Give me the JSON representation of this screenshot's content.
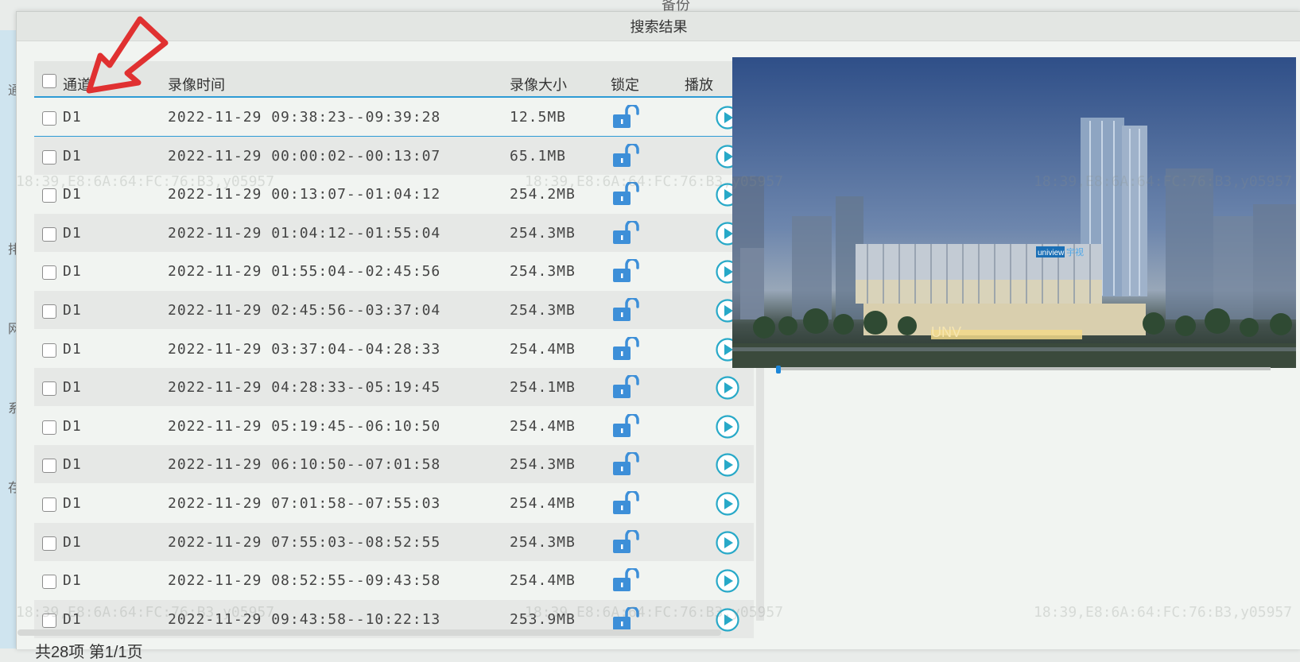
{
  "dialog": {
    "title": "搜索结果"
  },
  "background": {
    "top_text": "备份",
    "left_chars": [
      "通",
      "排",
      "网",
      "系",
      "存"
    ]
  },
  "table": {
    "headers": {
      "channel": "通道",
      "time": "录像时间",
      "size": "录像大小",
      "lock": "锁定",
      "play": "播放"
    },
    "rows": [
      {
        "channel": "D1",
        "time": "2022-11-29 09:38:23--09:39:28",
        "size": "12.5MB"
      },
      {
        "channel": "D1",
        "time": "2022-11-29 00:00:02--00:13:07",
        "size": "65.1MB"
      },
      {
        "channel": "D1",
        "time": "2022-11-29 00:13:07--01:04:12",
        "size": "254.2MB"
      },
      {
        "channel": "D1",
        "time": "2022-11-29 01:04:12--01:55:04",
        "size": "254.3MB"
      },
      {
        "channel": "D1",
        "time": "2022-11-29 01:55:04--02:45:56",
        "size": "254.3MB"
      },
      {
        "channel": "D1",
        "time": "2022-11-29 02:45:56--03:37:04",
        "size": "254.3MB"
      },
      {
        "channel": "D1",
        "time": "2022-11-29 03:37:04--04:28:33",
        "size": "254.4MB"
      },
      {
        "channel": "D1",
        "time": "2022-11-29 04:28:33--05:19:45",
        "size": "254.1MB"
      },
      {
        "channel": "D1",
        "time": "2022-11-29 05:19:45--06:10:50",
        "size": "254.4MB"
      },
      {
        "channel": "D1",
        "time": "2022-11-29 06:10:50--07:01:58",
        "size": "254.3MB"
      },
      {
        "channel": "D1",
        "time": "2022-11-29 07:01:58--07:55:03",
        "size": "254.4MB"
      },
      {
        "channel": "D1",
        "time": "2022-11-29 07:55:03--08:52:55",
        "size": "254.3MB"
      },
      {
        "channel": "D1",
        "time": "2022-11-29 08:52:55--09:43:58",
        "size": "254.4MB"
      },
      {
        "channel": "D1",
        "time": "2022-11-29 09:43:58--10:22:13",
        "size": "253.9MB"
      }
    ]
  },
  "footer": {
    "summary": "共28项  第1/1页"
  },
  "preview": {
    "logo_text": "uniview",
    "logo_cn": "宇视",
    "sign_text": "UNV"
  },
  "watermark": "18:39,E8:6A:64:FC:76:B3,y05957",
  "icons": {
    "lock": "unlocked-padlock-icon",
    "play": "play-circle-icon",
    "pointer": "arrow-pointer-icon"
  },
  "colors": {
    "accent": "#2d9bd5",
    "lock": "#3d8fd8",
    "play": "#28a9c8",
    "arrow": "#e03131"
  }
}
